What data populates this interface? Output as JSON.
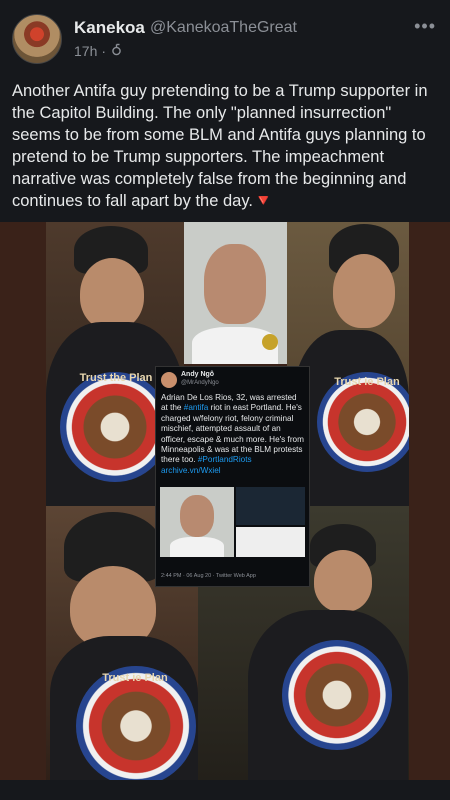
{
  "post": {
    "display_name": "Kanekoa",
    "handle": "@KanekoaTheGreat",
    "time": "17h",
    "separator": "·",
    "more_glyph": "•••",
    "body": "Another Antifa guy pretending to be a Trump supporter in the Capitol Building. The only \"planned insurrection\" seems to be from some BLM and Antifa guys planning to pretend to be Trump supporters. The impeachment narrative was completely false from the beginning and continues to fall apart by the day.",
    "body_mark": "🔻"
  },
  "media": {
    "shirt_text": "Trust the Plan",
    "shirt_text_short": "Trust ie Plan",
    "inset_tweet": {
      "name": "Andy Ngô",
      "handle": "@MrAndyNgo",
      "text_1": "Adrian De Los Rios, 32, was arrested at the ",
      "text_tag": "#antifa",
      "text_2": " riot in east Portland. He's charged w/felony riot, felony criminal mischief, attempted assault of an officer, escape & much more. He's from Minneapolis & was at the BLM protests there too.",
      "text_links": "#PortlandRiots archive.vn/Wxiel",
      "footer": "2:44 PM · 06 Aug 20 · Twitter Web App"
    }
  },
  "colors": {
    "background": "#16181c",
    "text": "#e7e9ea",
    "muted": "#8b8f96",
    "link": "#1d9bf0",
    "accent_red": "#f4473c"
  }
}
